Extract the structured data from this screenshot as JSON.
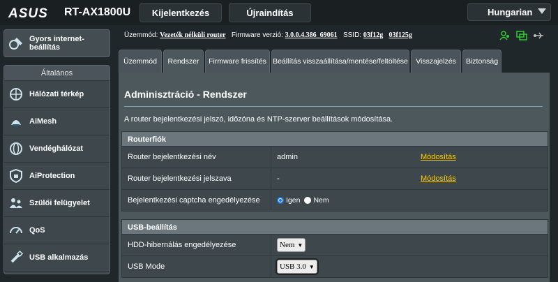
{
  "header": {
    "brand": "ASUS",
    "model": "RT-AX1800U",
    "logout_label": "Kijelentkezés",
    "reboot_label": "Újraindítás",
    "language": "Hungarian"
  },
  "sidebar": {
    "quick_label": "Gyors internet-beállítás",
    "section_title": "Általános",
    "items": [
      {
        "label": "Hálózati térkép",
        "icon": "network-map-icon"
      },
      {
        "label": "AiMesh",
        "icon": "aimesh-icon"
      },
      {
        "label": "Vendéghálózat",
        "icon": "guest-network-icon"
      },
      {
        "label": "AiProtection",
        "icon": "aiprotection-icon"
      },
      {
        "label": "Szülői felügyelet",
        "icon": "parental-control-icon"
      },
      {
        "label": "QoS",
        "icon": "qos-icon"
      },
      {
        "label": "USB alkalmazás",
        "icon": "usb-icon"
      }
    ]
  },
  "info": {
    "mode_label": "Üzemmód:",
    "mode_value": "Vezeték nélküli router",
    "fw_label": "Firmware verzió:",
    "fw_value": "3.0.0.4.386_69061",
    "ssid_label": "SSID:",
    "ssid1": "03f12g",
    "ssid2": "03f125g"
  },
  "tabs": [
    {
      "label": "Üzemmód"
    },
    {
      "label": "Rendszer"
    },
    {
      "label": "Firmware frissítés"
    },
    {
      "label": "Beállítás visszaállítása/mentése/feltöltése"
    },
    {
      "label": "Visszajelzés"
    },
    {
      "label": "Biztonság"
    }
  ],
  "main": {
    "title": "Adminisztráció - Rendszer",
    "description": "A router bejelentkezési jelszó, időzóna és NTP-szerver beállítások módosítása.",
    "router_section": "Routerfiók",
    "login_name_label": "Router bejelentkezési név",
    "login_name_value": "admin",
    "modify_label": "Módosítás",
    "password_label": "Router bejelentkezési jelszava",
    "password_value": "-",
    "captcha_label": "Bejelentkezési captcha engedélyezése",
    "yes_label": "Igen",
    "no_label": "Nem",
    "captcha_value": "Igen",
    "usb_section": "USB-beállítás",
    "hdd_label": "HDD-hibernálás engedélyezése",
    "hdd_value": "Nem",
    "usb_mode_label": "USB Mode",
    "usb_mode_value": "USB 3.0"
  },
  "colors": {
    "link": "#ffcc00",
    "background": "#20272b",
    "panel": "#4d585d",
    "status_icon": "#33cc33"
  }
}
